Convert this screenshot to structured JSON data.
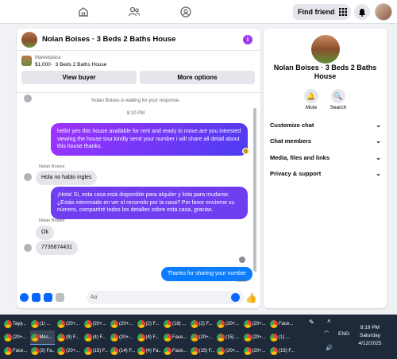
{
  "topnav": {
    "icons": [
      "home-icon",
      "friends-icon",
      "groups-icon"
    ],
    "find_friends": "Find friends"
  },
  "chat": {
    "title": "Nolan Boises · 3 Beds 2 Baths House",
    "marketplace_label": "Marketplace",
    "listing": "$1,000 · 3 Beds 2 Baths House",
    "view_buyer": "View buyer",
    "more_options": "More options",
    "waiting": "Nolan Boises is waiting for your response.",
    "time": "8:10 PM",
    "messages": {
      "out_1": "hello! yes this house available for rent and ready to move.are you intrested viewing the house tour.kindly send your number i will share all detail about this house thanks.",
      "sender_1": "Nolan Boises",
      "in_1": "Hola no hablo ingles",
      "out_2": "¡Hola! Sí, esta casa está disponible para alquiler y lista para mudarse. ¿Estás interesado en ver el recorrido por la casa? Por favor envíeme su número, compartiré todos los detalles sobre esta casa, gracias.",
      "sender_2": "Nolan Boises",
      "in_2": "Ok",
      "in_3": "7735874431",
      "out_3": "Thanks for sharing your number",
      "status": "Sent"
    },
    "composer_placeholder": "Aa"
  },
  "panel": {
    "name": "Nolan Boises · 3 Beds 2 Baths House",
    "mute": "Mute",
    "search": "Search",
    "rows": [
      "Customize chat",
      "Chat members",
      "Media, files and links",
      "Privacy & support"
    ]
  },
  "taskbar": {
    "row1": [
      "Tayy...",
      "(1) ...",
      "(20+...",
      "(20+...",
      "(20+...",
      "(2) F...",
      "(18) ...",
      "(2) F...",
      "(20+...",
      "(20+...",
      "Face..."
    ],
    "row2": [
      "(20+...",
      "Mes...",
      "(8) F...",
      "(4) F...",
      "(20+...",
      "(4) F...",
      "Face...",
      "(20+...",
      "(15) ...",
      "(20+...",
      "(1) ..."
    ],
    "row3": [
      "Face...",
      "(3) Fa...",
      "(20+...",
      "(15) F...",
      "(14) F...",
      "(4) Fa...",
      "Face...",
      "(15) F...",
      "(20+...",
      "(20+...",
      "(15) F..."
    ],
    "lang": "ENG",
    "time": "8:19 PM",
    "day": "Saturday",
    "date": "4/12/2025"
  }
}
